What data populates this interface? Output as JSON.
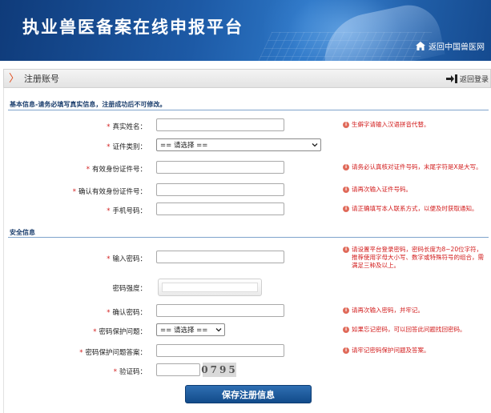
{
  "banner": {
    "title": "执业兽医备案在线申报平台",
    "back_home": "返回中国兽医网"
  },
  "section": {
    "title": "注册账号",
    "back_login": "返回登录"
  },
  "basic": {
    "heading": "基本信息-请务必填写真实信息，注册成功后不可修改。",
    "fields": [
      {
        "label": "真实姓名：",
        "value": "",
        "hint": "生僻字请输入汉语拼音代替。"
      },
      {
        "label": "证件类别：",
        "value": "== 请选择 ==",
        "hint": ""
      },
      {
        "label": "有效身份证件号：",
        "value": "",
        "hint": "请务必认真核对证件号码，末尾字符是X是大写。"
      },
      {
        "label": "确认有效身份证件号：",
        "value": "",
        "hint": "请再次输入证件号码。"
      },
      {
        "label": "手机号码：",
        "value": "",
        "hint": "请正确填写本人联系方式，以便及时获取通知。"
      }
    ]
  },
  "security": {
    "heading": "安全信息",
    "fields": [
      {
        "label": "输入密码：",
        "value": "",
        "hint": "请设置平台登录密码，密码长度为8~20位字符，推荐使用字母大小写、数字或特殊符号的组合，需满足三种及以上。"
      },
      {
        "label": "密码强度：",
        "value": "",
        "hint": ""
      },
      {
        "label": "确认密码：",
        "value": "",
        "hint": "请再次输入密码，并牢记。"
      },
      {
        "label": "密码保护问题：",
        "value": "== 请选择 ==",
        "hint": "如果忘记密码，可以回答此问题找回密码。"
      },
      {
        "label": "密码保护问题答案：",
        "value": "",
        "hint": "请牢记密码保护问题及答案。"
      },
      {
        "label": "验证码：",
        "value": "",
        "hint": ""
      }
    ],
    "captcha": "0795"
  },
  "submit_label": "保存注册信息",
  "colors": {
    "banner": "#1d5aa6",
    "required": "#d21b1b",
    "heading": "#1c3f6e",
    "submit": "#124b8a"
  }
}
